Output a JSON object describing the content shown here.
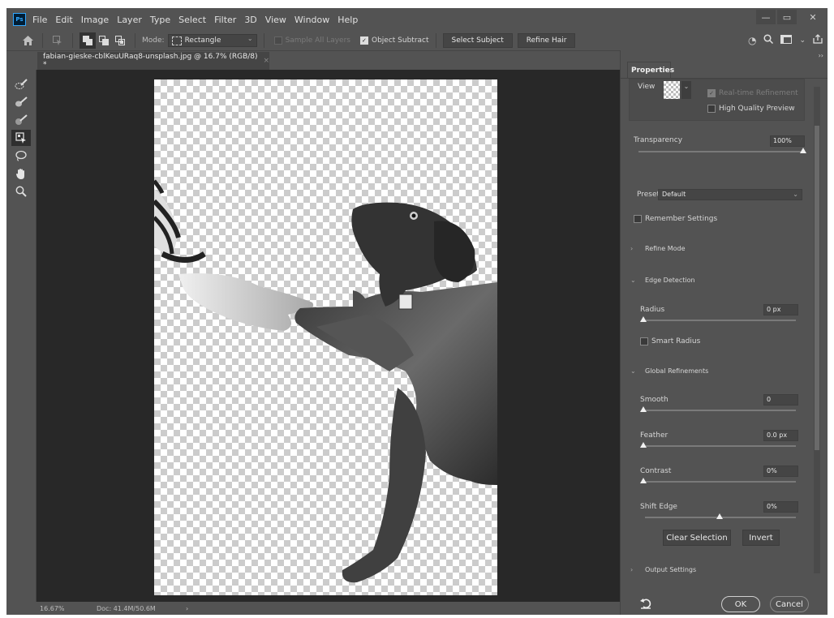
{
  "app": {
    "logo": "Ps"
  },
  "menu": [
    "File",
    "Edit",
    "Image",
    "Layer",
    "Type",
    "Select",
    "Filter",
    "3D",
    "View",
    "Window",
    "Help"
  ],
  "window_controls": {
    "minimize": "—",
    "restore": "▭",
    "close": "✕"
  },
  "options_bar": {
    "mode_label": "Mode:",
    "mode_value": "Rectangle",
    "sample_all_layers": "Sample All Layers",
    "object_subtract": "Object Subtract",
    "select_subject": "Select Subject",
    "refine_hair": "Refine Hair"
  },
  "document_tab": {
    "title": "fabian-gieske-cblKeuURaq8-unsplash.jpg @ 16.7% (RGB/8) *",
    "close": "×"
  },
  "status_bar": {
    "zoom": "16.67%",
    "doc": "Doc: 41.4M/50.6M",
    "arrow": "›"
  },
  "properties": {
    "tab": "Properties",
    "view_label": "View",
    "realtime_refinement": "Real-time Refinement",
    "high_quality_preview": "High Quality Preview",
    "transparency_label": "Transparency",
    "transparency_value": "100%",
    "transparency_level": 1.0,
    "preset_label": "Preset",
    "preset_value": "Default",
    "remember_settings": "Remember Settings",
    "refine_mode": "Refine Mode",
    "edge_detection": "Edge Detection",
    "radius_label": "Radius",
    "radius_value": "0 px",
    "smart_radius": "Smart Radius",
    "global_refinements": "Global Refinements",
    "smooth_label": "Smooth",
    "smooth_value": "0",
    "feather_label": "Feather",
    "feather_value": "0.0 px",
    "contrast_label": "Contrast",
    "contrast_value": "0%",
    "shift_edge_label": "Shift Edge",
    "shift_edge_value": "0%",
    "clear_selection": "Clear Selection",
    "invert": "Invert",
    "output_settings": "Output Settings",
    "ok": "OK",
    "cancel": "Cancel"
  }
}
